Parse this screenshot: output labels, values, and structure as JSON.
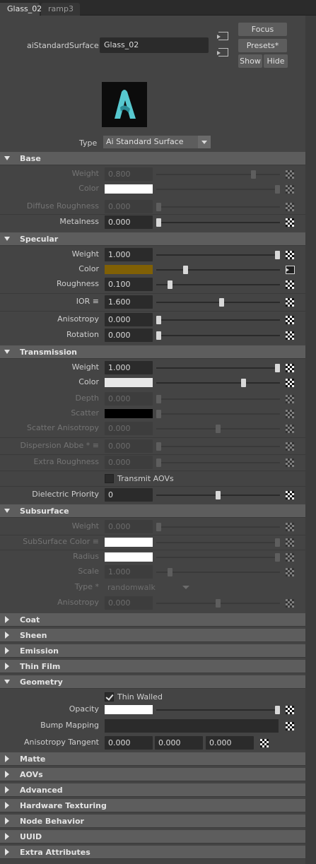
{
  "tabs": {
    "active": "Glass_02",
    "inactive": "ramp3"
  },
  "header": {
    "node_label": "aiStandardSurface:",
    "node_name": "Glass_02",
    "focus": "Focus",
    "presets": "Presets*",
    "show": "Show",
    "hide": "Hide",
    "type_label": "Type",
    "type_value": "Ai Standard Surface"
  },
  "sections": {
    "base": "Base",
    "specular": "Specular",
    "transmission": "Transmission",
    "subsurface": "Subsurface",
    "coat": "Coat",
    "sheen": "Sheen",
    "emission": "Emission",
    "thin_film": "Thin Film",
    "geometry": "Geometry",
    "matte": "Matte",
    "aovs": "AOVs",
    "advanced": "Advanced",
    "hardware_texturing": "Hardware Texturing",
    "node_behavior": "Node Behavior",
    "uuid": "UUID",
    "extra_attributes": "Extra Attributes"
  },
  "base": {
    "weight": {
      "label": "Weight",
      "value": "0.800",
      "level": 0.8
    },
    "color": {
      "label": "Color",
      "swatch": "#ffffff",
      "level": 1.0
    },
    "diffuse_roughness": {
      "label": "Diffuse Roughness",
      "value": "0.000",
      "level": 0.0
    },
    "metalness": {
      "label": "Metalness",
      "value": "0.000",
      "level": 0.0
    }
  },
  "specular": {
    "weight": {
      "label": "Weight",
      "value": "1.000",
      "level": 1.0
    },
    "color": {
      "label": "Color",
      "swatch": "#806005",
      "level": 0.23
    },
    "roughness": {
      "label": "Roughness",
      "value": "0.100",
      "level": 0.1
    },
    "ior": {
      "label": "IOR ≡",
      "value": "1.600",
      "level": 0.53
    },
    "anisotropy": {
      "label": "Anisotropy",
      "value": "0.000",
      "level": 0.0
    },
    "rotation": {
      "label": "Rotation",
      "value": "0.000",
      "level": 0.0
    }
  },
  "transmission": {
    "weight": {
      "label": "Weight",
      "value": "1.000",
      "level": 1.0
    },
    "color": {
      "label": "Color",
      "swatch": "#e8e8e8",
      "level": 0.7
    },
    "depth": {
      "label": "Depth",
      "value": "0.000",
      "level": 0.0
    },
    "scatter": {
      "label": "Scatter",
      "swatch": "#000000",
      "level": 0.0
    },
    "scatter_anisotropy": {
      "label": "Scatter Anisotropy",
      "value": "0.000",
      "level": 0.5
    },
    "dispersion_abbe": {
      "label": "Dispersion Abbe * ≡",
      "value": "0.000",
      "level": 0.0
    },
    "extra_roughness": {
      "label": "Extra Roughness",
      "value": "0.000",
      "level": 0.0
    },
    "transmit_aovs": {
      "label": "Transmit AOVs",
      "checked": false
    },
    "dielectric_priority": {
      "label": "Dielectric Priority",
      "value": "0",
      "level": 0.5
    }
  },
  "subsurface": {
    "weight": {
      "label": "Weight",
      "value": "0.000",
      "level": 0.0
    },
    "color": {
      "label": "SubSurface Color ≡",
      "swatch": "#ffffff",
      "level": 1.0
    },
    "radius": {
      "label": "Radius",
      "swatch": "#ffffff",
      "level": 1.0
    },
    "scale": {
      "label": "Scale",
      "value": "1.000",
      "level": 0.1
    },
    "type": {
      "label": "Type *",
      "value": "randomwalk"
    },
    "anisotropy": {
      "label": "Anisotropy",
      "value": "0.000",
      "level": 0.5
    }
  },
  "geometry": {
    "thin_walled": {
      "label": "Thin Walled",
      "checked": true
    },
    "opacity": {
      "label": "Opacity",
      "swatch": "#ffffff",
      "level": 1.0
    },
    "bump_mapping": {
      "label": "Bump Mapping"
    },
    "anisotropy_tangent": {
      "label": "Anisotropy Tangent",
      "values": [
        "0.000",
        "0.000",
        "0.000"
      ]
    }
  },
  "colors": {
    "accent_logo": "#57c8cf",
    "panel_bg": "#444444",
    "section_bg": "#5d5d5d"
  }
}
